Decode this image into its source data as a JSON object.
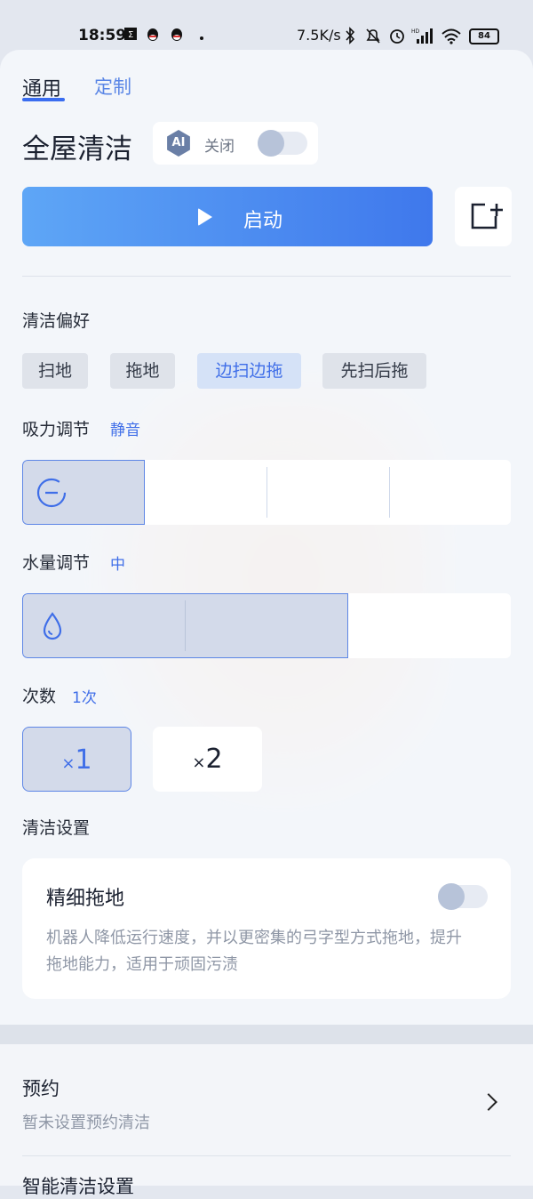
{
  "status_bar": {
    "time": "18:59",
    "network_speed": "7.5K/s",
    "battery": "84",
    "icons": [
      "notification-icon",
      "qq-icon",
      "qq-icon",
      "bluetooth-icon",
      "mute-icon",
      "alarm-icon",
      "signal-icon",
      "wifi-icon",
      "battery-icon"
    ]
  },
  "tabs": [
    {
      "label": "通用",
      "active": true
    },
    {
      "label": "定制",
      "active": false
    }
  ],
  "header": {
    "title": "全屋清洁",
    "ai_badge": "AI",
    "ai_status": "关闭",
    "ai_toggle_on": false
  },
  "start_button": {
    "label": "启动"
  },
  "clean_preference": {
    "label": "清洁偏好",
    "options": [
      "扫地",
      "拖地",
      "边扫边拖",
      "先扫后拖"
    ],
    "selected": "边扫边拖"
  },
  "suction": {
    "label": "吸力调节",
    "value": "静音",
    "level_fraction": 0.25
  },
  "water": {
    "label": "水量调节",
    "value": "中",
    "level_fraction": 0.667
  },
  "times": {
    "label": "次数",
    "value": "1次",
    "options": [
      {
        "x": "×",
        "n": "1"
      },
      {
        "x": "×",
        "n": "2"
      }
    ],
    "selected_index": 0
  },
  "clean_settings": {
    "label": "清洁设置",
    "fine_mop": {
      "title": "精细拖地",
      "description": "机器人降低运行速度，并以更密集的弓字型方式拖地，提升拖地能力，适用于顽固污渍",
      "on": false
    }
  },
  "schedule": {
    "title": "预约",
    "subtitle": "暂未设置预约清洁"
  },
  "smart_settings": {
    "title": "智能清洁设置"
  },
  "colors": {
    "accent": "#3f6ee8",
    "start_gradient_left": "#5ea6f6",
    "start_gradient_right": "#3f78ec"
  }
}
